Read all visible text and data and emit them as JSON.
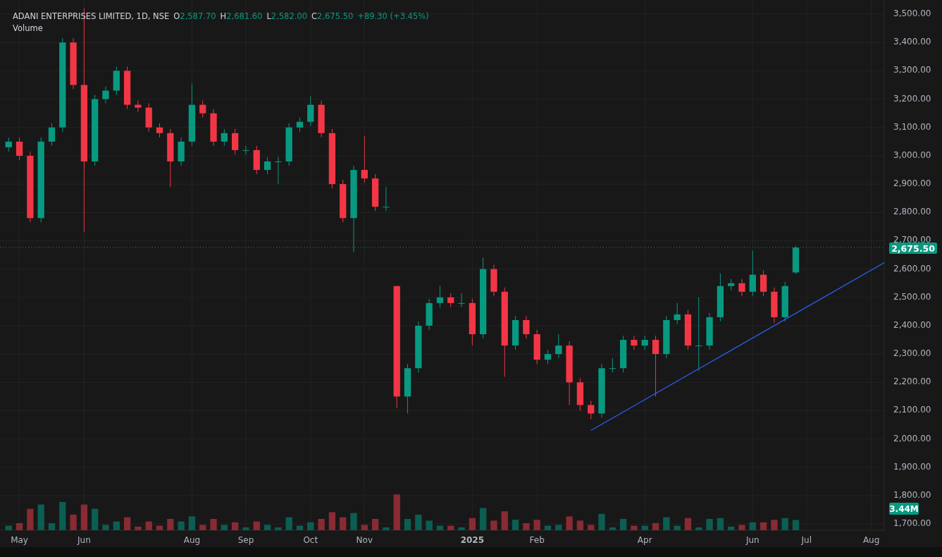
{
  "header": {
    "symbol": "ADANI ENTERPRISES LIMITED, 1D, NSE",
    "ohlc": [
      {
        "label": "O",
        "value": "2,587.70"
      },
      {
        "label": "H",
        "value": "2,681.60"
      },
      {
        "label": "L",
        "value": "2,582.00"
      },
      {
        "label": "C",
        "value": "2,675.50"
      }
    ],
    "change": "+89.30 (+3.45%)",
    "volume_label": "Volume"
  },
  "chart": {
    "volume_badge": "3.44M",
    "price_badge": "2,675.50",
    "chart_data": {
      "type": "candlestick",
      "categories": [
        null,
        "May",
        null,
        null,
        null,
        null,
        null,
        "Jun",
        null,
        null,
        null,
        null,
        null,
        null,
        null,
        null,
        null,
        "Aug",
        null,
        null,
        null,
        null,
        "Sep",
        null,
        null,
        null,
        null,
        null,
        "Oct",
        null,
        null,
        null,
        null,
        "Nov",
        null,
        null,
        null,
        null,
        null,
        null,
        null,
        null,
        null,
        "2025",
        null,
        null,
        null,
        null,
        null,
        "Feb",
        null,
        null,
        null,
        null,
        null,
        null,
        null,
        null,
        null,
        "Apr",
        null,
        null,
        null,
        null,
        null,
        null,
        null,
        null,
        null,
        "Jun",
        null,
        null,
        null,
        null,
        "Jul",
        null,
        null,
        null,
        null,
        null,
        "Aug",
        null
      ],
      "ohlc": [
        [
          3030,
          3065,
          3015,
          3050
        ],
        [
          3050,
          3065,
          2985,
          3000
        ],
        [
          3000,
          3015,
          2765,
          2780
        ],
        [
          2780,
          3065,
          2765,
          3050
        ],
        [
          3050,
          3115,
          3035,
          3100
        ],
        [
          3100,
          3415,
          3085,
          3400
        ],
        [
          3400,
          3415,
          3235,
          3250
        ],
        [
          3250,
          3520,
          2730,
          2980
        ],
        [
          2980,
          3215,
          2965,
          3200
        ],
        [
          3200,
          3245,
          3185,
          3230
        ],
        [
          3230,
          3315,
          3215,
          3300
        ],
        [
          3300,
          3315,
          3165,
          3180
        ],
        [
          3180,
          3195,
          3155,
          3170
        ],
        [
          3170,
          3185,
          3085,
          3100
        ],
        [
          3100,
          3115,
          3065,
          3080
        ],
        [
          3080,
          3095,
          2890,
          2980
        ],
        [
          2980,
          3065,
          2965,
          3050
        ],
        [
          3050,
          3255,
          3035,
          3180
        ],
        [
          3180,
          3195,
          3135,
          3150
        ],
        [
          3150,
          3165,
          3035,
          3050
        ],
        [
          3050,
          3095,
          3035,
          3080
        ],
        [
          3080,
          3095,
          3005,
          3020
        ],
        [
          3020,
          3035,
          3005,
          3020
        ],
        [
          3020,
          3035,
          2935,
          2950
        ],
        [
          2950,
          2995,
          2935,
          2980
        ],
        [
          2980,
          2995,
          2900,
          2980
        ],
        [
          2980,
          3115,
          2965,
          3100
        ],
        [
          3100,
          3135,
          3085,
          3120
        ],
        [
          3120,
          3210,
          3105,
          3180
        ],
        [
          3180,
          3195,
          3065,
          3080
        ],
        [
          3080,
          3095,
          2885,
          2900
        ],
        [
          2900,
          2915,
          2765,
          2780
        ],
        [
          2780,
          2965,
          2660,
          2950
        ],
        [
          2950,
          3070,
          2905,
          2920
        ],
        [
          2920,
          2935,
          2805,
          2820
        ],
        [
          2820,
          2890,
          2805,
          2820
        ],
        [
          2540,
          2540,
          2110,
          2150
        ],
        [
          2150,
          2265,
          2090,
          2250
        ],
        [
          2250,
          2415,
          2235,
          2400
        ],
        [
          2400,
          2495,
          2385,
          2480
        ],
        [
          2480,
          2540,
          2465,
          2500
        ],
        [
          2500,
          2515,
          2465,
          2480
        ],
        [
          2480,
          2515,
          2465,
          2480
        ],
        [
          2480,
          2495,
          2330,
          2370
        ],
        [
          2370,
          2640,
          2355,
          2600
        ],
        [
          2600,
          2615,
          2505,
          2520
        ],
        [
          2520,
          2535,
          2220,
          2330
        ],
        [
          2330,
          2435,
          2315,
          2420
        ],
        [
          2420,
          2435,
          2355,
          2370
        ],
        [
          2370,
          2385,
          2265,
          2280
        ],
        [
          2280,
          2315,
          2265,
          2300
        ],
        [
          2300,
          2370,
          2285,
          2330
        ],
        [
          2330,
          2345,
          2120,
          2200
        ],
        [
          2200,
          2215,
          2100,
          2120
        ],
        [
          2120,
          2135,
          2070,
          2090
        ],
        [
          2090,
          2265,
          2075,
          2250
        ],
        [
          2250,
          2285,
          2235,
          2250
        ],
        [
          2250,
          2365,
          2235,
          2350
        ],
        [
          2350,
          2365,
          2315,
          2330
        ],
        [
          2330,
          2365,
          2315,
          2350
        ],
        [
          2350,
          2365,
          2150,
          2300
        ],
        [
          2300,
          2435,
          2285,
          2420
        ],
        [
          2420,
          2480,
          2405,
          2440
        ],
        [
          2440,
          2455,
          2315,
          2330
        ],
        [
          2330,
          2500,
          2240,
          2330
        ],
        [
          2330,
          2445,
          2315,
          2430
        ],
        [
          2430,
          2585,
          2415,
          2540
        ],
        [
          2540,
          2565,
          2525,
          2550
        ],
        [
          2550,
          2565,
          2505,
          2520
        ],
        [
          2520,
          2665,
          2505,
          2580
        ],
        [
          2580,
          2595,
          2505,
          2520
        ],
        [
          2520,
          2535,
          2410,
          2430
        ],
        [
          2430,
          2555,
          2415,
          2540
        ],
        [
          2588,
          2682,
          2582,
          2676
        ],
        null,
        null,
        null,
        null,
        null,
        null,
        null,
        null
      ],
      "ylim": [
        1678,
        3550
      ],
      "yticks": [
        {
          "value": 1700,
          "label": "1,700.00"
        },
        {
          "value": 1800,
          "label": "1,800.00"
        },
        {
          "value": 1900,
          "label": "1,900.00"
        },
        {
          "value": 2000,
          "label": "2,000.00"
        },
        {
          "value": 2100,
          "label": "2,100.00"
        },
        {
          "value": 2200,
          "label": "2,200.00"
        },
        {
          "value": 2300,
          "label": "2,300.00"
        },
        {
          "value": 2400,
          "label": "2,400.00"
        },
        {
          "value": 2500,
          "label": "2,500.00"
        },
        {
          "value": 2600,
          "label": "2,600.00"
        },
        {
          "value": 2700,
          "label": "2,700.00"
        },
        {
          "value": 2800,
          "label": "2,800.00"
        },
        {
          "value": 2900,
          "label": "2,900.00"
        },
        {
          "value": 3000,
          "label": "3,000.00"
        },
        {
          "value": 3100,
          "label": "3,100.00"
        },
        {
          "value": 3200,
          "label": "3,200.00"
        },
        {
          "value": 3300,
          "label": "3,300.00"
        },
        {
          "value": 3400,
          "label": "3,400.00"
        },
        {
          "value": 3500,
          "label": "3,500.00"
        }
      ],
      "grid": true
    }
  }
}
